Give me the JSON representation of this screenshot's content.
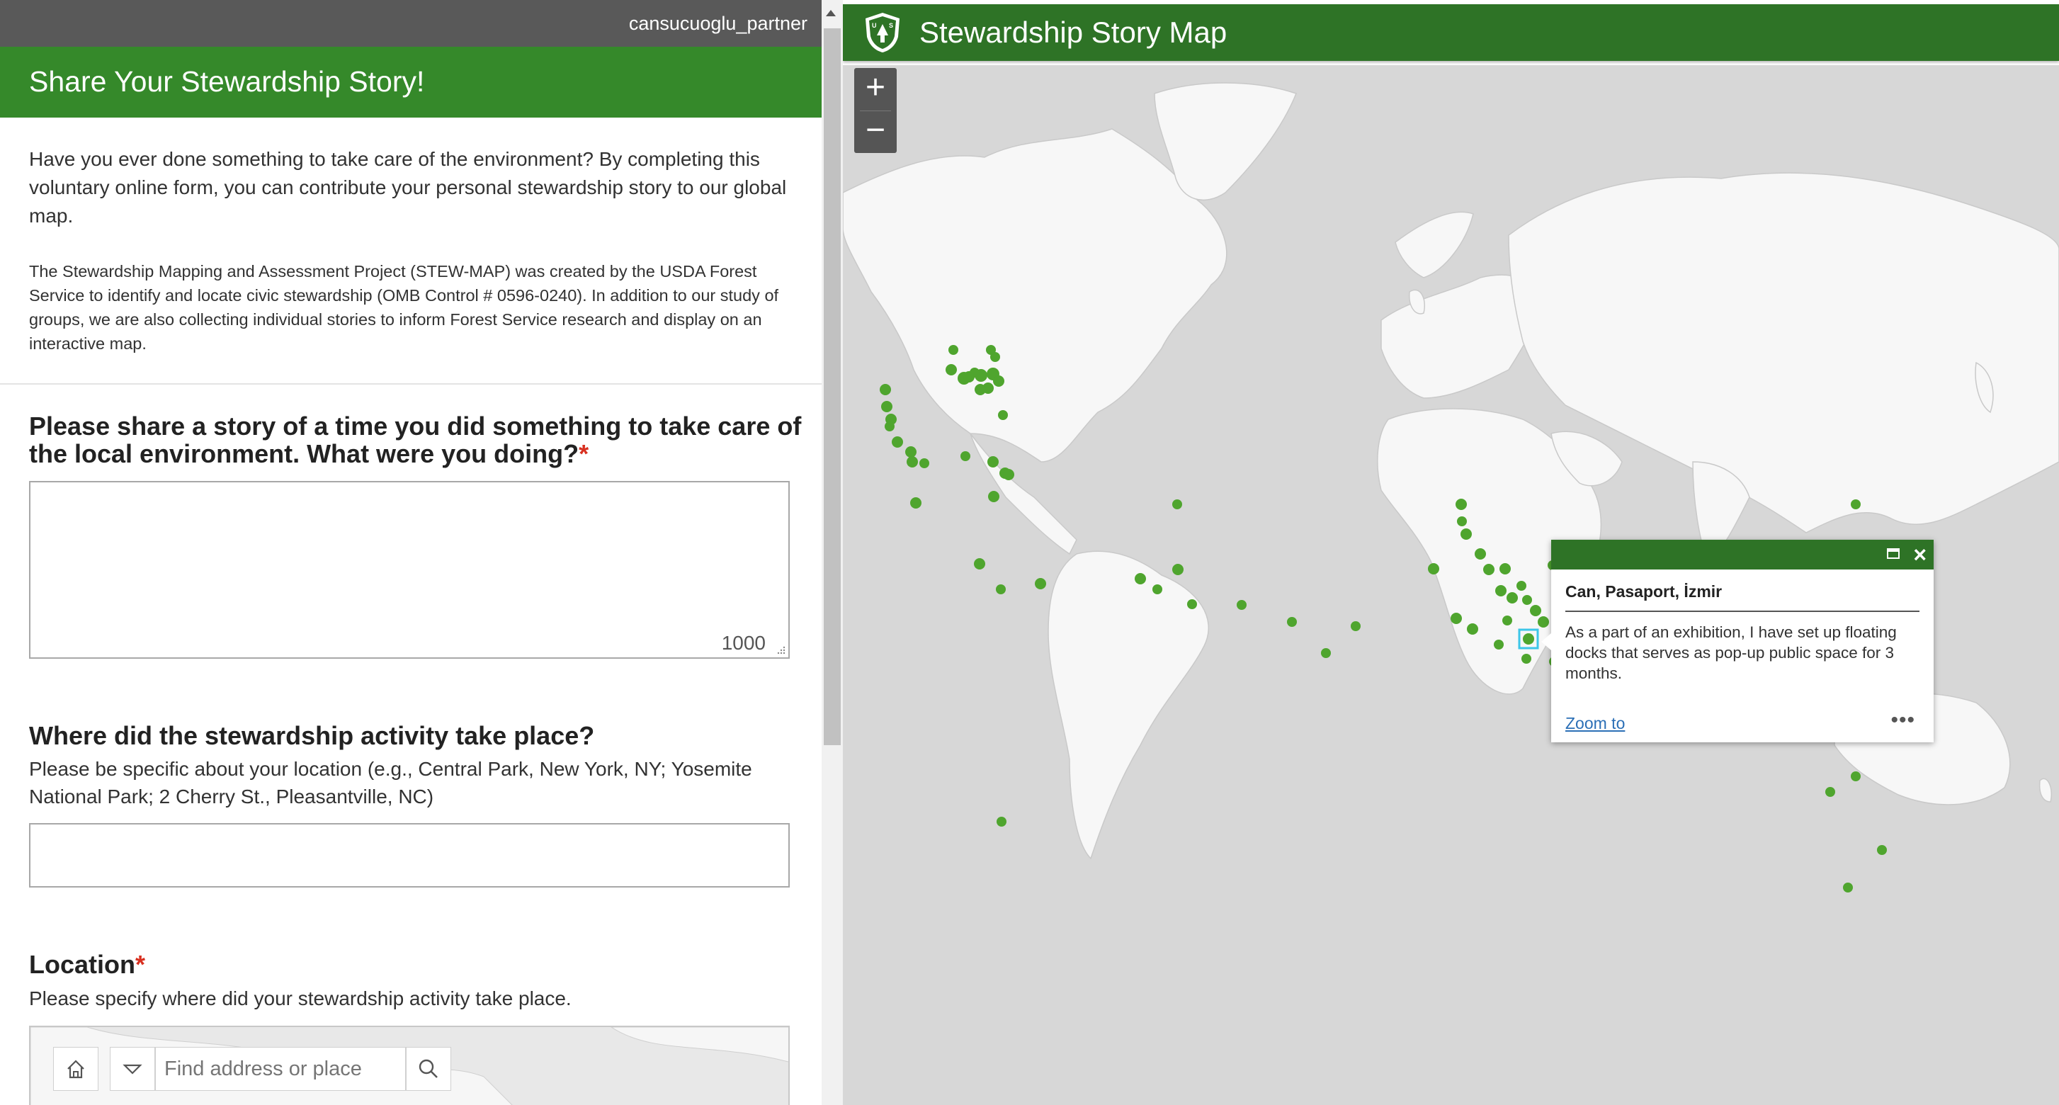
{
  "form": {
    "username": "cansucuoglu_partner",
    "title": "Share Your Stewardship Story!",
    "intro_main": "Have you ever done something to take care of the environment? By completing this voluntary online form, you can contribute your personal stewardship story to our global map.",
    "intro_detail": "The Stewardship Mapping and Assessment Project (STEW-MAP) was created by the USDA Forest Service to identify and locate civic stewardship (OMB Control # 0596-0240). In addition to our study of groups, we are also collecting individual stories to inform Forest Service research and display on an interactive map.",
    "q_story": "Please share a story of a time you did something to take care of the local environment. What were you doing?",
    "required_mark": "*",
    "story_char_limit": "1000",
    "q_where": "Where did the stewardship activity take place?",
    "where_help": "Please be specific about your location (e.g., Central Park, New York, NY; Yosemite National Park; 2 Cherry St., Pleasantville, NC)",
    "q_location": "Location",
    "location_help": "Please specify where did your stewardship activity take place.",
    "search_placeholder": "Find address or place"
  },
  "map": {
    "title": "Stewardship Story Map",
    "zoom_in": "+",
    "zoom_out": "−",
    "popup": {
      "title": "Can, Pasaport, İzmir",
      "body": "As a part of an exhibition, I have set up floating docks that serves as pop-up public space for 3 months.",
      "zoom_link": "Zoom to",
      "more": "•••"
    }
  },
  "colors": {
    "form_header": "#35892a",
    "map_header": "#2e7326",
    "marker": "#4fa52e",
    "land": "#f7f7f7",
    "water": "#d7d7d7"
  }
}
